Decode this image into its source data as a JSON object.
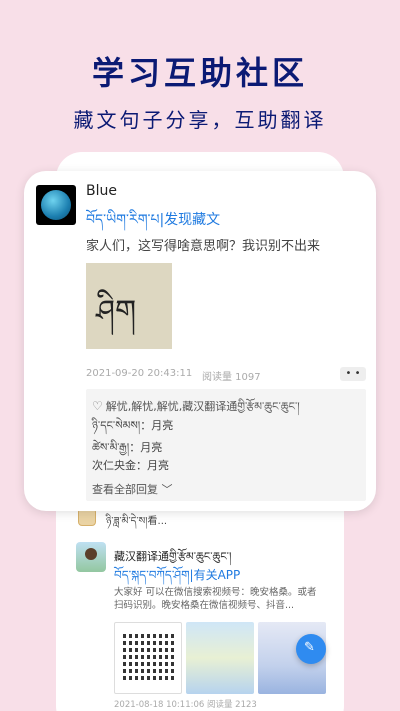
{
  "hero": {
    "title": "学习互助社区",
    "subtitle": "藏文句子分享，互助翻译"
  },
  "main_post": {
    "username": "Blue",
    "topic": "བོད་ཡིག་རིག་པ|发现藏文",
    "question": "家人们，这写得啥意思啊？我识别不出来",
    "image_text": "ཤིག",
    "time": "2021-09-20 20:43:11",
    "views": "阅读量 1097",
    "more": "• •",
    "likes": "解忧,解忧,解忧,藏汉翻译通གྱི་རྩོམ་ཆུང་ཆུང་།",
    "replies": [
      {
        "text": "ཉི་དང་སེམས།：月亮"
      },
      {
        "text": "ཚེས་མི་རྒྱ།：月亮"
      },
      {
        "text": "次仁央金：月亮"
      }
    ],
    "view_all": "查看全部回复"
  },
  "background_feed": {
    "row_text": "ཉི་ཟླ་མི་དེ་ས།看...",
    "post": {
      "username": "藏汉翻译通གྱི་རྩོམ་ཆུང་ཆུང་།",
      "topic": "བོད་སྐད་བཀོད་ཤོག|有关APP",
      "body": "大家好 可以在微信搜索视频号：晚安格桑。或者扫码识别。晚安格桑在微信视频号、抖音...",
      "meta": "2021-08-18 10:11:06  阅读量 2123"
    }
  },
  "fab": {
    "icon": "edit-icon",
    "glyph": "✎"
  }
}
